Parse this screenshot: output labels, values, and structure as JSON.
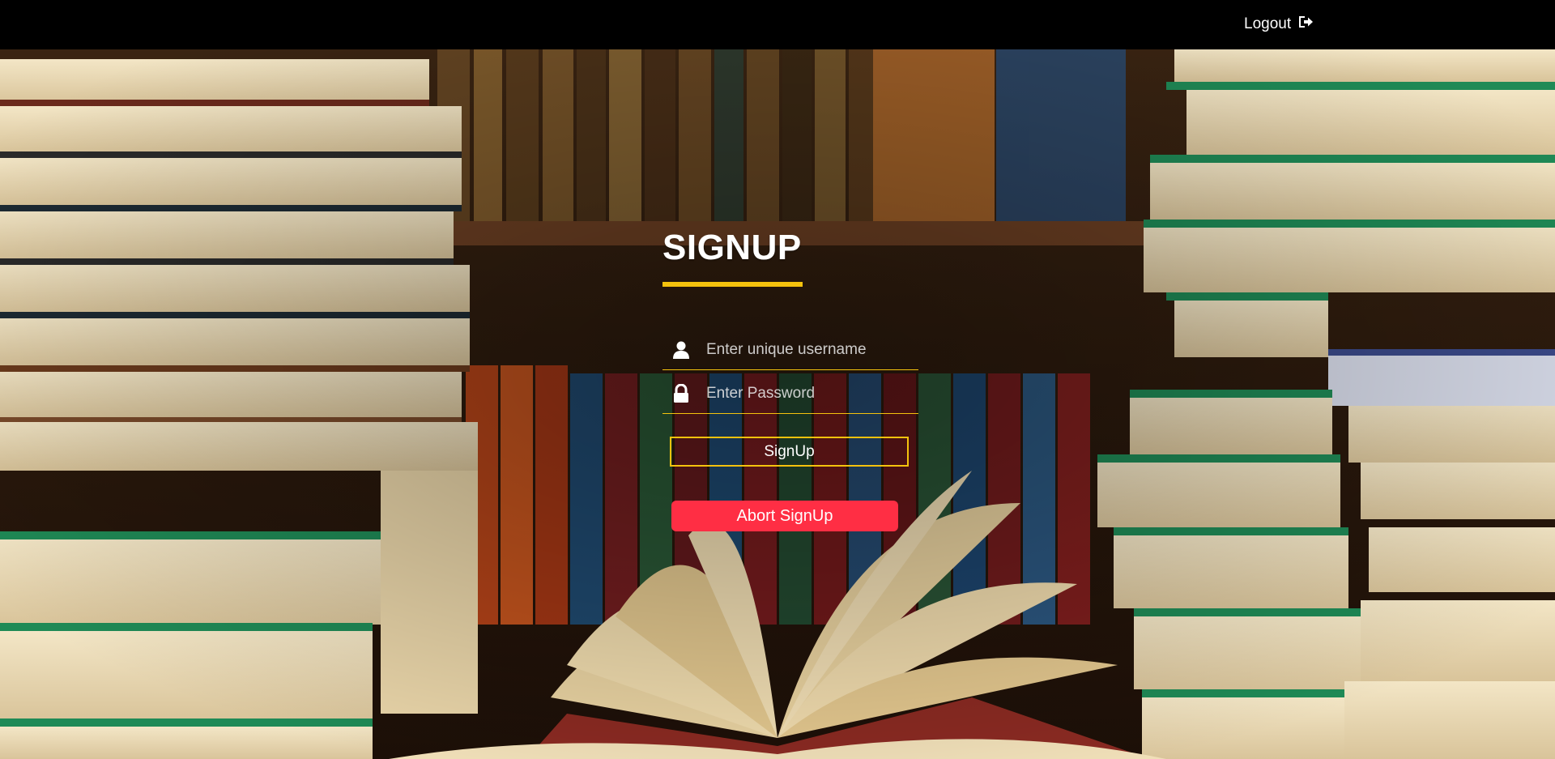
{
  "header": {
    "logout_label": "Logout",
    "logout_icon": "sign-out-icon"
  },
  "form": {
    "title": "SIGNUP",
    "username": {
      "placeholder": "Enter unique username",
      "value": "",
      "icon": "user-icon"
    },
    "password": {
      "placeholder": "Enter Password",
      "value": "",
      "icon": "lock-icon"
    },
    "signup_label": "SignUp",
    "abort_label": "Abort SignUp"
  },
  "colors": {
    "accent": "#f4c20d",
    "abort": "#ff2e44",
    "topbar": "#000000"
  },
  "background": {
    "description_icon": "library-books-photo"
  }
}
